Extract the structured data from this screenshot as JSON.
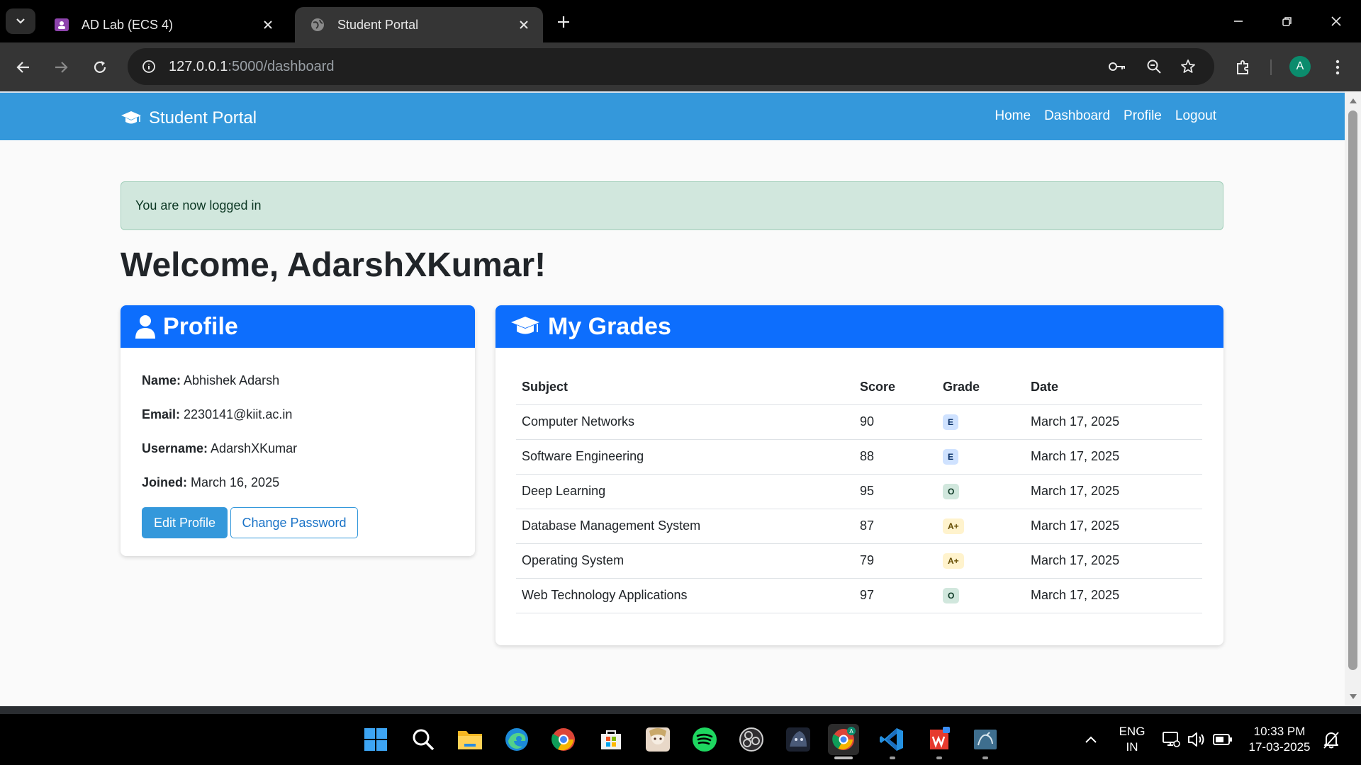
{
  "browser": {
    "tabs": [
      {
        "title": "AD Lab (ECS 4)",
        "active": false
      },
      {
        "title": "Student Portal",
        "active": true
      }
    ],
    "url_host": "127.0.0.1",
    "url_rest": ":5000/dashboard",
    "profile_initial": "A"
  },
  "navbar": {
    "brand": "Student Portal",
    "links": [
      "Home",
      "Dashboard",
      "Profile",
      "Logout"
    ]
  },
  "alert": {
    "message": "You are now logged in"
  },
  "welcome": "Welcome, AdarshXKumar!",
  "profile": {
    "heading": "Profile",
    "fields": [
      {
        "label": "Name:",
        "value": " Abhishek Adarsh"
      },
      {
        "label": "Email:",
        "value": " 2230141@kiit.ac.in"
      },
      {
        "label": "Username:",
        "value": " AdarshXKumar"
      },
      {
        "label": "Joined:",
        "value": " March 16, 2025"
      }
    ],
    "edit_button": "Edit Profile",
    "password_button": "Change Password"
  },
  "grades": {
    "heading": "My Grades",
    "columns": [
      "Subject",
      "Score",
      "Grade",
      "Date"
    ],
    "rows": [
      {
        "subject": "Computer Networks",
        "score": "90",
        "grade": "E",
        "date": "March 17, 2025"
      },
      {
        "subject": "Software Engineering",
        "score": "88",
        "grade": "E",
        "date": "March 17, 2025"
      },
      {
        "subject": "Deep Learning",
        "score": "95",
        "grade": "O",
        "date": "March 17, 2025"
      },
      {
        "subject": "Database Management System",
        "score": "87",
        "grade": "A+",
        "date": "March 17, 2025"
      },
      {
        "subject": "Operating System",
        "score": "79",
        "grade": "A+",
        "date": "March 17, 2025"
      },
      {
        "subject": "Web Technology Applications",
        "score": "97",
        "grade": "O",
        "date": "March 17, 2025"
      }
    ],
    "badge_colors": {
      "E": "#cfe2ff",
      "O": "#d1e7dd",
      "A+": "#fff3cd"
    }
  },
  "taskbar": {
    "language": "ENG",
    "region": "IN",
    "time": "10:33 PM",
    "date": "17-03-2025",
    "apps": [
      "start-icon",
      "search-icon",
      "file-explorer-icon",
      "edge-icon",
      "chrome-icon",
      "store-icon",
      "game-icon",
      "spotify-icon",
      "obs-icon",
      "game2-icon",
      "chrome-profile-icon",
      "vscode-icon",
      "wps-icon",
      "mysql-icon"
    ]
  },
  "colors": {
    "navbar": "#3498db",
    "card_header": "#0d6efd",
    "alert_bg": "#d1e7dd"
  }
}
